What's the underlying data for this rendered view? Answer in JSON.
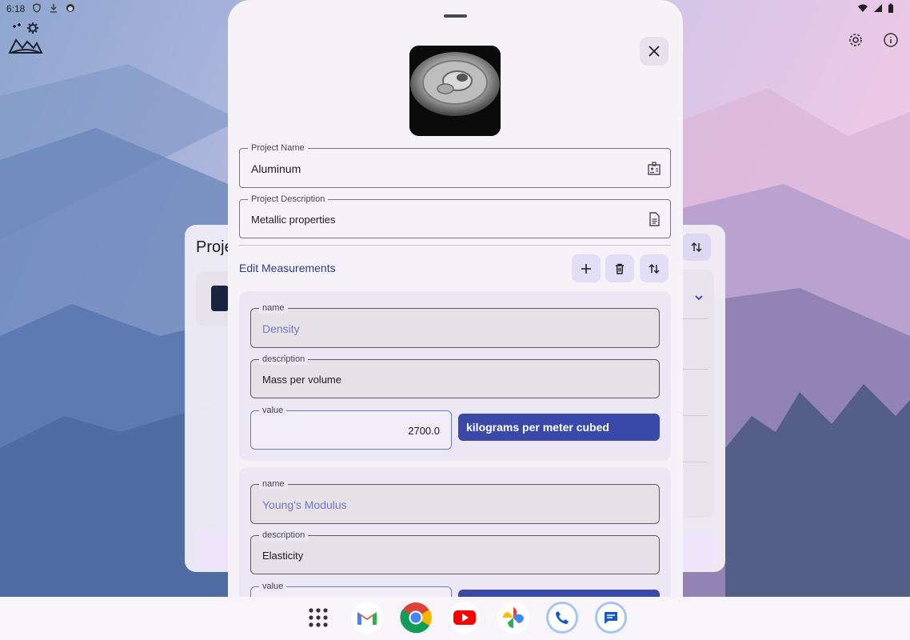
{
  "status_bar": {
    "time": "6:18",
    "left_icons": [
      "shield-icon",
      "download-icon",
      "face-icon"
    ],
    "right_icons": [
      "wifi-icon",
      "signal-icon",
      "battery-icon"
    ]
  },
  "app": {
    "title_partial": "Proje",
    "top_icons": [
      "settings-icon",
      "info-icon"
    ]
  },
  "sheet": {
    "project_name": {
      "label": "Project Name",
      "value": "Aluminum"
    },
    "project_description": {
      "label": "Project Description",
      "value": "Metallic properties"
    },
    "measurements_title": "Edit Measurements",
    "toolbar": [
      "add-icon",
      "delete-icon",
      "sort-icon"
    ],
    "measurements": [
      {
        "name_label": "name",
        "name": "Density",
        "description_label": "description",
        "description": "Mass per volume",
        "value_label": "value",
        "value": "2700.0",
        "unit": "kilograms per meter cubed"
      },
      {
        "name_label": "name",
        "name": "Young's Modulus",
        "description_label": "description",
        "description": "Elasticity",
        "value_label": "value",
        "value": "",
        "unit": ""
      }
    ]
  },
  "dock": [
    "app-drawer-icon",
    "gmail-icon",
    "chrome-icon",
    "youtube-icon",
    "photos-icon",
    "phone-icon",
    "messages-icon"
  ],
  "colors": {
    "accent": "#3a48a8",
    "sheet_bg": "#f6f3f8",
    "card_bg": "#ece7f4"
  }
}
